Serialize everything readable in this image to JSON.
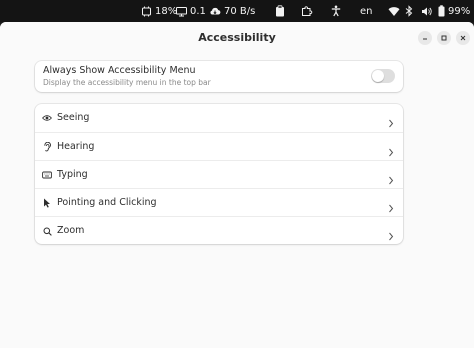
{
  "topbar": {
    "cpu": "18%",
    "mem": "0.1",
    "net": "70 B/s",
    "lang": "en",
    "battery": "99%",
    "icons": [
      "cpu-chip-icon",
      "monitor-icon",
      "cloud-download-icon",
      "clipboard-icon",
      "puzzle-icon",
      "accessibility-icon",
      "wifi-icon",
      "bluetooth-icon",
      "volume-icon",
      "battery-icon"
    ]
  },
  "window": {
    "title": "Accessibility",
    "buttons": [
      "minimize",
      "maximize",
      "close"
    ]
  },
  "always_show": {
    "title": "Always Show Accessibility Menu",
    "subtitle": "Display the accessibility menu in the top bar",
    "enabled": false
  },
  "items": [
    {
      "label": "Seeing",
      "icon": "eye-icon"
    },
    {
      "label": "Hearing",
      "icon": "ear-icon"
    },
    {
      "label": "Typing",
      "icon": "keyboard-icon"
    },
    {
      "label": "Pointing and Clicking",
      "icon": "pointer-icon"
    },
    {
      "label": "Zoom",
      "icon": "magnifier-icon"
    }
  ]
}
